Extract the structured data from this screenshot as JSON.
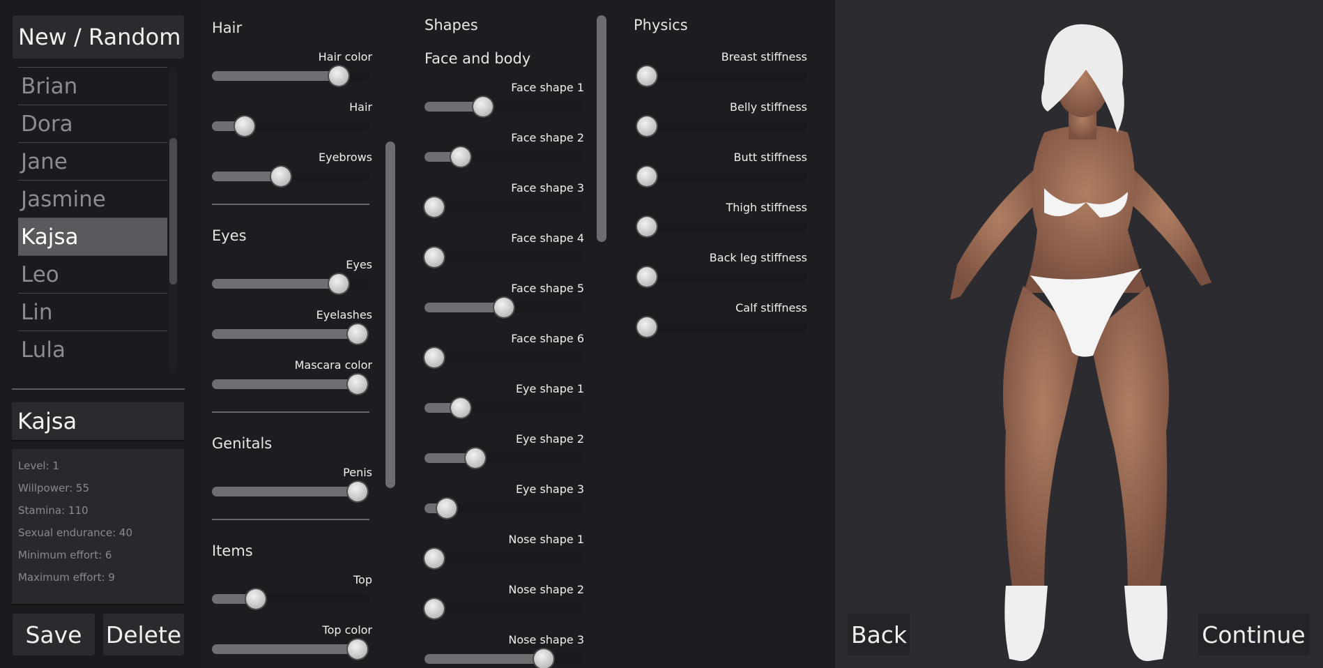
{
  "left": {
    "new_random_label": "New / Random",
    "characters": [
      "Brian",
      "Dora",
      "Jane",
      "Jasmine",
      "Kajsa",
      "Leo",
      "Lin",
      "Lula"
    ],
    "selected_character": "Kajsa",
    "name_value": "Kajsa",
    "stats": [
      "Level: 1",
      "Willpower: 55",
      "Stamina: 110",
      "Sexual endurance: 40",
      "Minimum effort: 6",
      "Maximum effort: 9"
    ],
    "save_label": "Save",
    "delete_label": "Delete"
  },
  "panel1": {
    "sections": [
      {
        "title": "Hair",
        "sliders": [
          {
            "label": "Hair color",
            "value": 0.81
          },
          {
            "label": "Hair",
            "value": 0.21
          },
          {
            "label": "Eyebrows",
            "value": 0.44
          }
        ]
      },
      {
        "title": "Eyes",
        "sliders": [
          {
            "label": "Eyes",
            "value": 0.81
          },
          {
            "label": "Eyelashes",
            "value": 0.93
          },
          {
            "label": "Mascara color",
            "value": 0.93
          }
        ]
      },
      {
        "title": "Genitals",
        "sliders": [
          {
            "label": "Penis",
            "value": 0.93
          }
        ]
      },
      {
        "title": "Items",
        "sliders": [
          {
            "label": "Top",
            "value": 0.28
          },
          {
            "label": "Top color",
            "value": 0.93
          }
        ]
      }
    ]
  },
  "panel2": {
    "title": "Shapes",
    "subtitle": "Face and body",
    "sliders": [
      {
        "label": "Face shape 1",
        "value": 0.37
      },
      {
        "label": "Face shape 2",
        "value": 0.23
      },
      {
        "label": "Face shape 3",
        "value": 0.06
      },
      {
        "label": "Face shape 4",
        "value": 0.06
      },
      {
        "label": "Face shape 5",
        "value": 0.5
      },
      {
        "label": "Face shape 6",
        "value": 0.06
      },
      {
        "label": "Eye shape 1",
        "value": 0.23
      },
      {
        "label": "Eye shape 2",
        "value": 0.32
      },
      {
        "label": "Eye shape 3",
        "value": 0.14
      },
      {
        "label": "Nose shape 1",
        "value": 0.06
      },
      {
        "label": "Nose shape 2",
        "value": 0.06
      },
      {
        "label": "Nose shape 3",
        "value": 0.75
      }
    ]
  },
  "panel3": {
    "title": "Physics",
    "sliders": [
      {
        "label": "Breast stiffness",
        "value": 0.06
      },
      {
        "label": "Belly stiffness",
        "value": 0.06
      },
      {
        "label": "Butt stiffness",
        "value": 0.06
      },
      {
        "label": "Thigh stiffness",
        "value": 0.06
      },
      {
        "label": "Back leg stiffness",
        "value": 0.06
      },
      {
        "label": "Calf stiffness",
        "value": 0.06
      }
    ]
  },
  "nav": {
    "back_label": "Back",
    "continue_label": "Continue"
  }
}
